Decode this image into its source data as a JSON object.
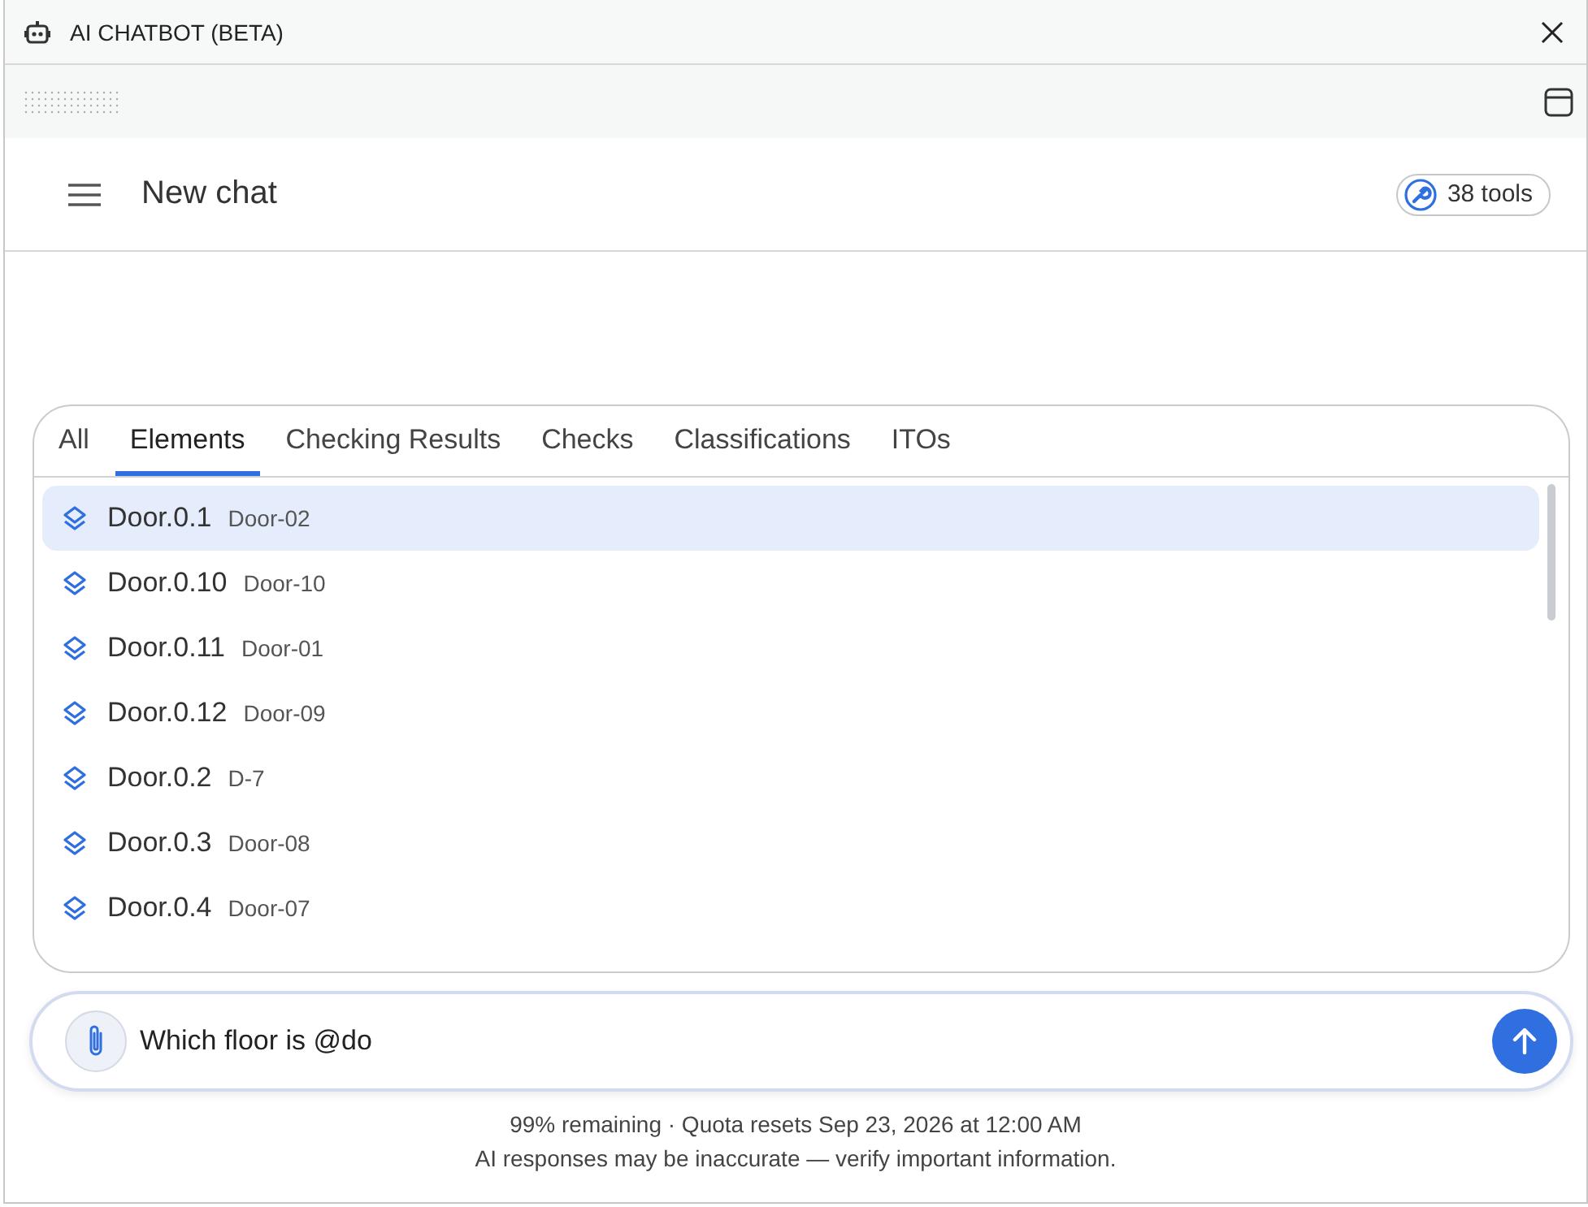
{
  "window": {
    "title": "AI CHATBOT (BETA)"
  },
  "header": {
    "title": "New chat",
    "tools_badge": "38 tools"
  },
  "mention_popup": {
    "tabs": [
      {
        "label": "All",
        "selected": false
      },
      {
        "label": "Elements",
        "selected": true
      },
      {
        "label": "Checking Results",
        "selected": false
      },
      {
        "label": "Checks",
        "selected": false
      },
      {
        "label": "Classifications",
        "selected": false
      },
      {
        "label": "ITOs",
        "selected": false
      }
    ],
    "items": [
      {
        "name": "Door.0.1",
        "label": "Door-02",
        "selected": true
      },
      {
        "name": "Door.0.10",
        "label": "Door-10",
        "selected": false
      },
      {
        "name": "Door.0.11",
        "label": "Door-01",
        "selected": false
      },
      {
        "name": "Door.0.12",
        "label": "Door-09",
        "selected": false
      },
      {
        "name": "Door.0.2",
        "label": "D-7",
        "selected": false
      },
      {
        "name": "Door.0.3",
        "label": "Door-08",
        "selected": false
      },
      {
        "name": "Door.0.4",
        "label": "Door-07",
        "selected": false
      }
    ]
  },
  "composer": {
    "value": "Which floor is @do"
  },
  "footer": {
    "quota": "99% remaining · Quota resets Sep 23, 2026 at 12:00 AM",
    "disclaimer": "AI responses may be inaccurate — verify important information."
  }
}
